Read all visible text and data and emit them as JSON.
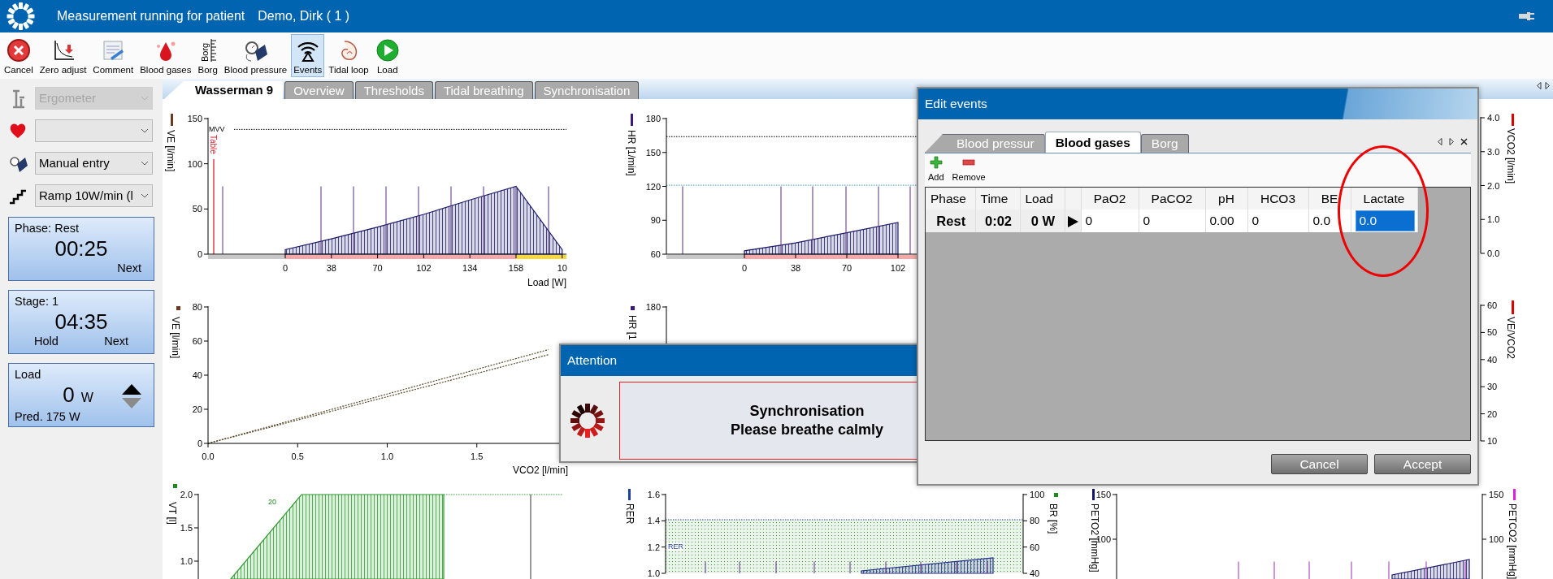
{
  "window": {
    "title": "Measurement running for patient",
    "patient": "Demo, Dirk ( 1 )"
  },
  "toolbar": [
    {
      "label": "Cancel",
      "kind": "cancel",
      "selected": false
    },
    {
      "label": "Zero adjust",
      "kind": "zero",
      "selected": false
    },
    {
      "label": "Comment",
      "kind": "comment",
      "selected": false
    },
    {
      "label": "Blood gases",
      "kind": "drop",
      "selected": false
    },
    {
      "label": "Borg",
      "kind": "borg",
      "icon_text": "Borg",
      "selected": false
    },
    {
      "label": "Blood pressure",
      "kind": "cuff",
      "selected": false
    },
    {
      "label": "Events",
      "kind": "events",
      "selected": true
    },
    {
      "label": "Tidal loop",
      "kind": "loop",
      "selected": false
    },
    {
      "label": "Load",
      "kind": "play",
      "selected": false
    }
  ],
  "devices": [
    {
      "kind": "ergometer",
      "value": "Ergometer",
      "disabled": true
    },
    {
      "kind": "heart",
      "disabled": false
    },
    {
      "kind": "cuff",
      "value": "Manual entry",
      "disabled": false
    },
    {
      "kind": "steps",
      "value": "Ramp 10W/min (l",
      "disabled": false
    }
  ],
  "timers": [
    {
      "title": "Phase: Rest",
      "time": "00:25",
      "actions": [
        "Next"
      ]
    },
    {
      "title": "Stage: 1",
      "time": "04:35",
      "actions": [
        "Hold",
        "Next"
      ]
    }
  ],
  "load": {
    "title": "Load",
    "value": "0",
    "unit": "W",
    "note": "Pred. 175 W",
    "up_disabled": false,
    "down_disabled": true
  },
  "tabs": [
    {
      "label": "Wasserman 9",
      "selected": true
    },
    {
      "label": "Overview",
      "selected": false
    },
    {
      "label": "Thresholds",
      "selected": false
    },
    {
      "label": "Tidal breathing",
      "selected": false
    },
    {
      "label": "Synchronisation",
      "selected": false
    }
  ],
  "panels": [
    {
      "color": "#6b3a1e",
      "labels": [
        "Table"
      ],
      "chart_data": {
        "type": "area",
        "ylabel": "VE [l/min]",
        "xlabel": "Load [W]",
        "categories": [
          "0",
          "38",
          "70",
          "102",
          "134",
          "158",
          "10"
        ],
        "series": [
          {
            "color": "#1c1c6b",
            "values": [
              5,
              17,
              30,
              44,
              60,
              75,
              5
            ]
          }
        ],
        "ylim": [
          0,
          150
        ],
        "yticks": [
          0,
          50,
          100,
          150
        ],
        "ref_lines": [
          {
            "axis": "y",
            "value": 138,
            "label": "MVV",
            "color": "#000000"
          }
        ]
      }
    },
    {
      "color": "#3a1a7a",
      "chart_data": {
        "type": "area",
        "ylabel": "HR [1/min]",
        "categories": [
          "0",
          "38",
          "70",
          "102"
        ],
        "series": [
          {
            "color": "#1c1c6b",
            "values": [
              63,
              70,
              79,
              88
            ]
          }
        ],
        "ylim": [
          60,
          180
        ],
        "yticks": [
          60,
          90,
          120,
          150,
          180
        ],
        "ref_lines": [
          {
            "axis": "y",
            "value": 164,
            "color": "#000000"
          },
          {
            "axis": "y",
            "value": 121,
            "color": "#3aa0c8"
          }
        ]
      }
    },
    {
      "color": "#e00000",
      "axis": {
        "label": "VCO2 [l/min]",
        "ticks": [
          "4.0",
          "3.0",
          "2.0",
          "1.0",
          "0.0"
        ]
      }
    },
    {
      "color": "#6b3a1e",
      "chart_data": {
        "type": "line",
        "ylabel": "VE [l/min]",
        "xlabel": "VCO2 [l/min]",
        "x": [
          0,
          1.9
        ],
        "series": [
          {
            "color": "#5a4a2a",
            "line_style": "dotted",
            "values": [
              0,
              55
            ]
          },
          {
            "color": "#5a4a2a",
            "line_style": "dotted",
            "values": [
              0,
              52
            ]
          }
        ],
        "xlim": [
          0,
          2.0
        ],
        "ylim": [
          0,
          80
        ],
        "yticks": [
          0,
          20,
          40,
          60,
          80
        ],
        "xticks": [
          {
            "value": 0,
            "label": "0.0"
          },
          {
            "value": 0.5,
            "label": "0.5"
          },
          {
            "value": 1,
            "label": "1.0"
          },
          {
            "value": 1.5,
            "label": "1.5"
          }
        ]
      }
    },
    {
      "color": "#3a1a7a",
      "axis": {
        "label": "HR [1",
        "ticks": [
          "180"
        ]
      }
    },
    {
      "color": "#e00000",
      "axis": {
        "label": "VE/VCO2",
        "ticks": [
          "60",
          "50",
          "40",
          "30",
          "20",
          "10"
        ]
      }
    },
    {
      "color": "#1f8a1f",
      "labels": [
        "20"
      ],
      "axis": {
        "label": "VT [l]",
        "ticks": [
          "2.0",
          "1.5",
          "1.0"
        ]
      }
    },
    {
      "color": "#1f3fa0",
      "labels": [
        "RER"
      ],
      "axis": {
        "label": "RER",
        "ticks": [
          "1.6",
          "1.4",
          "1.2",
          "1.0"
        ]
      },
      "right_axis": {
        "label": "BR [%]",
        "color": "#1f8a1f",
        "ticks": [
          "100",
          "80",
          "60",
          "40"
        ]
      }
    },
    {
      "color": "#14146e",
      "axis": {
        "label": "PETO2 [mmHg]",
        "ticks": [
          "150",
          "100"
        ]
      },
      "right_axis": {
        "label": "PETCO2 [mmHg]",
        "color": "#e020e0",
        "ticks": [
          "150",
          "100"
        ]
      }
    }
  ],
  "attention": {
    "title": "Attention",
    "heading": "Synchronisation",
    "message": "Please breathe calmly"
  },
  "edit_events": {
    "title": "Edit events",
    "tabs": [
      {
        "label": "Blood pressur",
        "selected": false
      },
      {
        "label": "Blood gases",
        "selected": true
      },
      {
        "label": "Borg",
        "selected": false
      }
    ],
    "tools": [
      {
        "kind": "add",
        "label": "Add"
      },
      {
        "kind": "remove",
        "label": "Remove"
      }
    ],
    "columns": [
      {
        "label": "Phase",
        "kind": "fixed"
      },
      {
        "label": "Time",
        "kind": "fixed"
      },
      {
        "label": "Load",
        "kind": "fixed"
      },
      {
        "label": "PaO2",
        "kind": "entry"
      },
      {
        "label": "PaCO2",
        "kind": "entry"
      },
      {
        "label": "pH",
        "kind": "entry"
      },
      {
        "label": "HCO3",
        "kind": "entry"
      },
      {
        "label": "BE",
        "kind": "entry"
      },
      {
        "label": "Lactate",
        "kind": "entry"
      }
    ],
    "rows": [
      {
        "current": true,
        "cells": [
          {
            "text": "Rest",
            "selected": false
          },
          {
            "text": "0:02",
            "selected": false
          },
          {
            "text": "0 W",
            "selected": false
          },
          {
            "text": "0",
            "selected": false
          },
          {
            "text": "0",
            "selected": false
          },
          {
            "text": "0.00",
            "selected": false
          },
          {
            "text": "0",
            "selected": false
          },
          {
            "text": "0.0",
            "selected": false
          },
          {
            "text": "0.0",
            "selected": true
          }
        ]
      }
    ],
    "buttons": [
      "Cancel",
      "Accept"
    ]
  }
}
